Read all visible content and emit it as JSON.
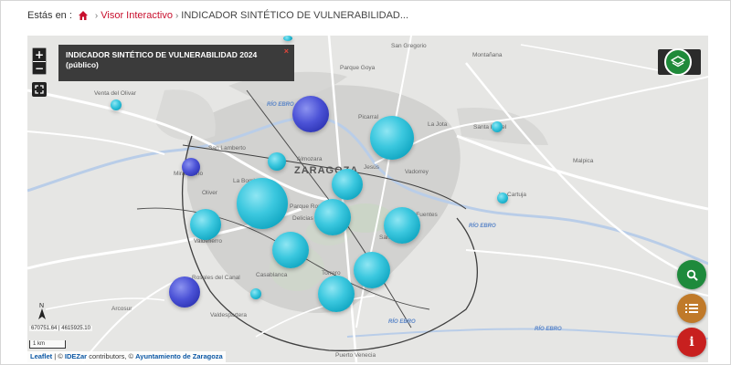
{
  "breadcrumb": {
    "label": "Estás en :",
    "home_icon": "home-icon",
    "link": "Visor Interactivo",
    "current": "INDICADOR SINTÉTICO DE VULNERABILIDAD..."
  },
  "map": {
    "info_title": "INDICADOR SINTÉTICO DE VULNERABILIDAD 2024 (público)",
    "info_close": "×",
    "zoom_in": "+",
    "zoom_out": "−",
    "coords": "670751.64 | 4615925.10",
    "scale": "1 km",
    "attribution": {
      "leaflet": "Leaflet",
      "sep1": " | © ",
      "idezar": "IDEZar",
      "mid": " contributors, © ",
      "ayto": "Ayuntamiento de Zaragoza"
    },
    "city_label": "ZARAGOZA",
    "river_labels": [
      "RÍO EBRO",
      "RÍO EBRO",
      "RÍO EBRO",
      "RÍO EBRO"
    ],
    "place_labels": [
      "San Gregorio",
      "Montañana",
      "Parque Goya",
      "Venta del Olivar",
      "Picarral",
      "San Lamberto",
      "Almozara",
      "Jesús",
      "Vadorrey",
      "Santa Isabel",
      "Malpica",
      "Miralbueno",
      "Oliver",
      "La Bombarda",
      "Parque Roma",
      "Delicias",
      "Torrero",
      "Casablanca",
      "Valdefierro",
      "Valdespartera",
      "Arcosur",
      "Las Fuentes",
      "San José",
      "La Jota",
      "Puerto Venecia",
      "Rosales del Canal",
      "La Cartuja"
    ],
    "bubbles": [
      {
        "color": "blue",
        "value": 4
      },
      {
        "color": "cyan",
        "value": 5
      },
      {
        "color": "cyan",
        "value": 1
      },
      {
        "color": "cyan",
        "value": 1
      },
      {
        "color": "blue",
        "value": 2
      },
      {
        "color": "cyan",
        "value": 2
      },
      {
        "color": "cyan",
        "value": 3
      },
      {
        "color": "cyan",
        "value": 6
      },
      {
        "color": "cyan",
        "value": 4
      },
      {
        "color": "cyan",
        "value": 3
      },
      {
        "color": "cyan",
        "value": 1
      },
      {
        "color": "cyan",
        "value": 4
      },
      {
        "color": "cyan",
        "value": 4
      },
      {
        "color": "blue",
        "value": 3
      },
      {
        "color": "cyan",
        "value": 1
      },
      {
        "color": "cyan",
        "value": 4
      },
      {
        "color": "cyan",
        "value": 4
      }
    ]
  },
  "controls": {
    "layers_icon": "layers-icon",
    "search_icon": "search-icon",
    "list_icon": "list-icon",
    "info_icon": "i"
  },
  "colors": {
    "accent_red": "#c8102e",
    "green": "#1e8a3c",
    "orange": "#c07a2a",
    "red": "#c8201f",
    "bubble_cyan": "#22b8d2",
    "bubble_blue": "#3c44c8"
  }
}
